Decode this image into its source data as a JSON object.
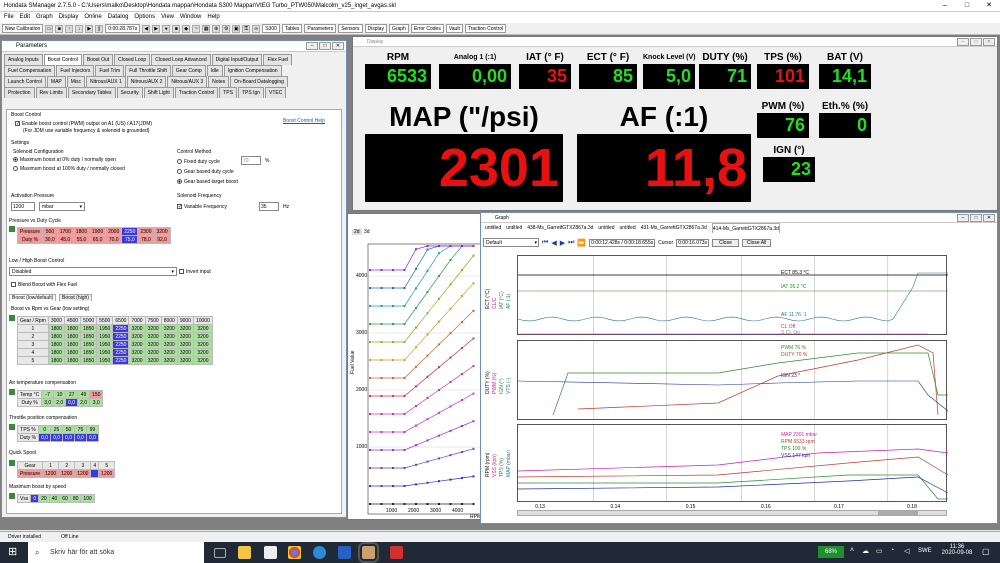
{
  "titlebar": {
    "title": "Hondata SManager 2.7.5.0 - C:\\Users\\malko\\Desktop\\Hondata mappar\\Hondata S300 Mappar\\VtEG Turbo_PTW050\\Malcolm_v25_inget_avgas.skl",
    "min": "–",
    "max": "□",
    "close": "✕"
  },
  "menu": [
    "File",
    "Edit",
    "Graph",
    "Display",
    "Online",
    "Datalog",
    "Options",
    "View",
    "Window",
    "Help"
  ],
  "toolbar": {
    "calibration": "New Calibration",
    "time": "0:00:28.787s",
    "buttons": [
      "S300",
      "Tables",
      "Parameters",
      "Sensors",
      "Display",
      "Graph",
      "Error Codes",
      "Vault",
      "Traction Control"
    ]
  },
  "params": {
    "title": "Parameters",
    "tabs_row1": [
      "Analog Inputs",
      "Boost Control",
      "Boost Out",
      "Closed Loop",
      "Closed Loop Advanced",
      "Digital Input/Output",
      "Flex Fuel"
    ],
    "tabs_row2": [
      "Fuel Compensation",
      "Fuel Injectors",
      "Fuel Trim",
      "Full Throttle Shift",
      "Gear Comp",
      "Idle",
      "Ignition Compensation"
    ],
    "tabs_row3": [
      "Launch Control",
      "MAP",
      "Misc",
      "Nitrous/AUX 1",
      "Nitrous/AUX 2",
      "Nitrous/AUX 3",
      "Notes",
      "On-Board Datalogging"
    ],
    "tabs_row4": [
      "Protection",
      "Rev Limits",
      "Secondary Tables",
      "Security",
      "Shift Light",
      "Traction Control",
      "TPS",
      "TPS Ign",
      "VTEC"
    ],
    "bc_heading": "Boost Control",
    "bc_help": "Boost Control Help",
    "enable_boost": "Enable boost control (PWM) output on A1 (US) / A17(JDM)",
    "enable_note": "(For JDM use variable frequency & solenoid is grounded)",
    "settings": "Settings",
    "solenoid_config": "Solenoid Configuration",
    "sol_opt1": "Maximum boost at 0% duty / normally open",
    "sol_opt2": "Maximum boost at 100% duty / normally closed",
    "control_method": "Control Method",
    "cm_opt1": "Fixed duty cycle",
    "cm_opt1_val": "70",
    "cm_opt2": "Gear based duty cycle",
    "cm_opt3": "Gear based target boost",
    "activation_pressure": "Activation Pressure",
    "act_value": "1200",
    "act_unit": "mbar",
    "solenoid_frequency": "Solenoid Frequency",
    "variable_freq": "Variable Frequency",
    "freq_value": "35",
    "freq_unit": "Hz",
    "pvd_title": "Pressure vs Duty Cycle",
    "pvd_rows": [
      [
        "Pressure",
        "500",
        "1700",
        "1800",
        "1900",
        "2000",
        "2250",
        "2300",
        "3200"
      ],
      [
        "Duty %",
        "30,0",
        "45,0",
        "55,0",
        "65,0",
        "70,0",
        "75,0",
        "78,0",
        "92,0"
      ]
    ],
    "lowhigh_title": "Low / High Boost Control",
    "lowhigh_value": "Disabled",
    "invert_input": "Invert input",
    "blend_flex": "Blend Boost with Flex Fuel",
    "boost_tabs": [
      "Boost (low/default)",
      "Boost (high)"
    ],
    "boost_grid_title": "Boost vs Rpm vs Gear (low setting)",
    "boost_header": [
      "Gear / Rpm",
      "3000",
      "4500",
      "5000",
      "5500",
      "6500",
      "7000",
      "7500",
      "8000",
      "9000",
      "10000"
    ],
    "boost_rows": [
      [
        "1",
        "1800",
        "1800",
        "1850",
        "1950",
        "2250",
        "3200",
        "3200",
        "3200",
        "3200",
        "3200"
      ],
      [
        "2",
        "1800",
        "1800",
        "1850",
        "1950",
        "2250",
        "3200",
        "3200",
        "3200",
        "3200",
        "3200"
      ],
      [
        "3",
        "1800",
        "1800",
        "1850",
        "1950",
        "2250",
        "3200",
        "3200",
        "3200",
        "3200",
        "3200"
      ],
      [
        "4",
        "1800",
        "1800",
        "1850",
        "1950",
        "2250",
        "3200",
        "3200",
        "3200",
        "3200",
        "3200"
      ],
      [
        "5",
        "1800",
        "1800",
        "1850",
        "1950",
        "2250",
        "3200",
        "3200",
        "3200",
        "3200",
        "3200"
      ]
    ],
    "air_temp_title": "Air temperature compensation",
    "air_temp_rows": [
      [
        "Temp °C",
        "-7",
        "10",
        "27",
        "49",
        "150"
      ],
      [
        "Duty %",
        "3,0",
        "2,0",
        "0,0",
        "2,0",
        "3,0"
      ]
    ],
    "tps_title": "Throttle position compensation",
    "tps_rows": [
      [
        "TPS %",
        "0",
        "25",
        "50",
        "75",
        "99"
      ],
      [
        "Duty %",
        "0,0",
        "0,0",
        "0,0",
        "0,0",
        "0,0"
      ]
    ],
    "quick_spool": "Quick Spool",
    "qs_rows": [
      [
        "Gear",
        "1",
        "2",
        "3",
        "4",
        "5"
      ],
      [
        "Pressure",
        "1200",
        "1200",
        "1200",
        "",
        "1200"
      ]
    ],
    "max_speed": "Maximum boost by speed",
    "ms_row": [
      "Vss",
      "0",
      "20",
      "40",
      "60",
      "80",
      "100"
    ]
  },
  "display": {
    "title": "Display",
    "gauges": [
      {
        "label": "RPM",
        "value": "6533",
        "color": "#1ee01e"
      },
      {
        "label": "Analog 1 (:1)",
        "value": "0,00",
        "color": "#1ee01e"
      },
      {
        "label": "IAT (° F)",
        "value": "35",
        "color": "#e81010"
      },
      {
        "label": "ECT (° F)",
        "value": "85",
        "color": "#1ee01e"
      },
      {
        "label": "Knock Level (V)",
        "value": "5,0",
        "color": "#1ee01e"
      },
      {
        "label": "DUTY (%)",
        "value": "71",
        "color": "#1ee01e"
      },
      {
        "label": "TPS (%)",
        "value": "101",
        "color": "#e81010"
      },
      {
        "label": "BAT (V)",
        "value": "14,1",
        "color": "#1ee01e"
      }
    ],
    "map_label": "MAP (\"/psi)",
    "map_value": "2301",
    "af_label": "AF (:1)",
    "af_value": "11,8",
    "pwm_label": "PWM (%)",
    "pwm_value": "76",
    "eth_label": "Eth.% (%)",
    "eth_value": "0",
    "ign_label": "IGN (°)",
    "ign_value": "23"
  },
  "plot": {
    "tabs": [
      "2d",
      "3d"
    ],
    "ylabel": "Fuel Value",
    "yticks": [
      "4000",
      "3000",
      "2000",
      "1000"
    ],
    "xticks": [
      "1000",
      "2000",
      "3000",
      "4000"
    ],
    "xlabel": "RPM"
  },
  "graph": {
    "title": "Graph",
    "tabs": [
      "untitled",
      "untitled",
      "438-Ms_GarrettGTX2867a.3d",
      "untitled",
      "untitled",
      "431-Ms_GarrettGTX2867a.3d",
      "414-Ms_GarrettGTX2867a.3d"
    ],
    "preset": "Default",
    "times": "0:00:12.428s / 0:00:18.655s",
    "cursor_label": "Cursor",
    "cursor_val": "0:00:16.073s",
    "close": "Close",
    "close_all": "Close All",
    "panel1_axis": [
      "ECT (°C)",
      "CL/C",
      "IAT (°C)",
      "AF (:1)"
    ],
    "panel1_labels": [
      "ECT 85.3 °C",
      "IAT 35.2 °C",
      "AF 11.76 :1",
      "CL Off",
      "S.CL On"
    ],
    "panel2_axis": [
      "DUTY (%)",
      "PWM (%)",
      "IGN (°)",
      "VTS (-)"
    ],
    "panel2_labels": [
      "PWM 76 %",
      "DUTY 70 %",
      "IGN 23 °"
    ],
    "panel3_axis": [
      "RPM (rpm)",
      "VSS (kph)",
      "TPS (%)",
      "MAP (mbar)"
    ],
    "panel3_labels": [
      "MAP 2301 mbar",
      "RPM 6533 rpm",
      "TPS 100 %",
      "VSS 147 kph"
    ],
    "xticks": [
      "0.13",
      "0.14",
      "0.15",
      "0.16",
      "0.17",
      "0.18"
    ]
  },
  "status": {
    "driver": "Driver installed",
    "mode": "Off Line"
  },
  "taskbar": {
    "search": "Skriv här för att söka",
    "battery": "68%",
    "lang": "SWE",
    "time": "11:36",
    "date": "2020-09-08"
  }
}
